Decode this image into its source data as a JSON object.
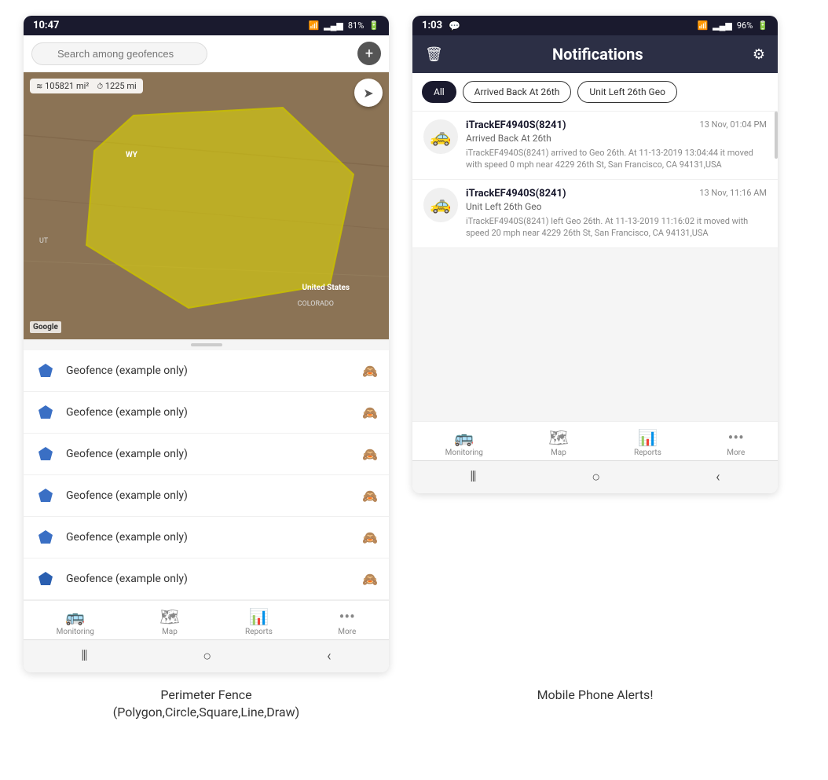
{
  "left_phone": {
    "status_bar": {
      "time": "10:47",
      "wifi": "WiFi",
      "signal": "Signal",
      "battery": "81%"
    },
    "search": {
      "placeholder": "Search among geofences"
    },
    "map": {
      "stat1": "105821 mi²",
      "stat2": "1225 mi",
      "label_us": "United States",
      "label_co": "COLORADO",
      "label_wy": "WY",
      "label_ut": "UT",
      "google": "Google"
    },
    "geofence_items": [
      {
        "name": "Geofence (example only)"
      },
      {
        "name": "Geofence (example only)"
      },
      {
        "name": "Geofence (example only)"
      },
      {
        "name": "Geofence (example only)"
      },
      {
        "name": "Geofence (example only)"
      },
      {
        "name": "Geofence (example only)"
      }
    ],
    "bottom_nav": [
      {
        "label": "Monitoring"
      },
      {
        "label": "Map"
      },
      {
        "label": "Reports"
      },
      {
        "label": "More"
      }
    ]
  },
  "right_phone": {
    "status_bar": {
      "time": "1:03",
      "battery": "96%"
    },
    "header": {
      "title": "Notifications"
    },
    "filter_tabs": [
      {
        "label": "All",
        "active": true
      },
      {
        "label": "Arrived Back At 26th",
        "active": false
      },
      {
        "label": "Unit Left 26th Geo",
        "active": false
      }
    ],
    "notifications": [
      {
        "device": "iTrackEF4940S(8241)",
        "time": "13 Nov, 01:04 PM",
        "event": "Arrived Back At 26th",
        "desc": "iTrackEF4940S(8241) arrived to Geo 26th.   At 11-13-2019 13:04:44 it moved with speed 0 mph near 4229 26th St, San Francisco, CA 94131,USA"
      },
      {
        "device": "iTrackEF4940S(8241)",
        "time": "13 Nov, 11:16 AM",
        "event": "Unit Left 26th Geo",
        "desc": "iTrackEF4940S(8241) left Geo 26th.   At 11-13-2019 11:16:02 it moved with speed 20 mph near 4229 26th St, San Francisco, CA 94131,USA"
      }
    ],
    "bottom_nav": [
      {
        "label": "Monitoring"
      },
      {
        "label": "Map"
      },
      {
        "label": "Reports"
      },
      {
        "label": "More"
      }
    ]
  },
  "captions": {
    "left": "Perimeter Fence\n(Polygon,Circle,Square,Line,Draw)",
    "right": "Mobile Phone Alerts!"
  }
}
